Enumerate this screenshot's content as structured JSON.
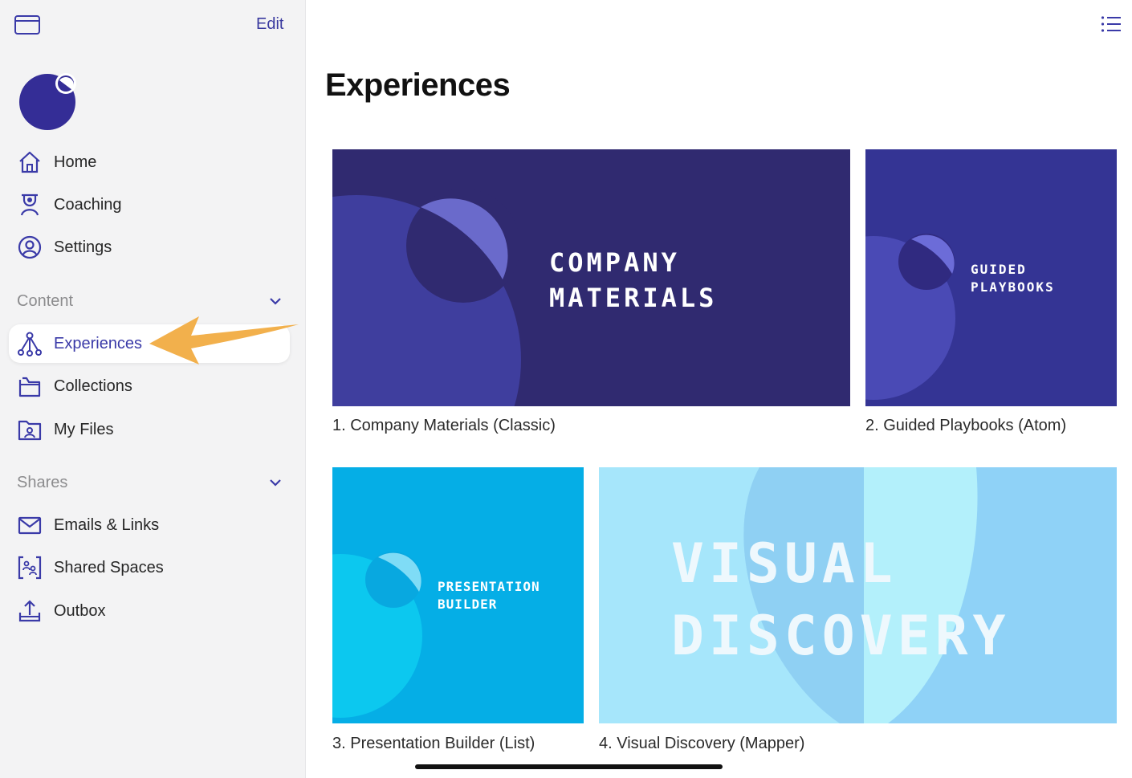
{
  "sidebar": {
    "edit_label": "Edit",
    "nav": [
      {
        "label": "Home",
        "icon": "home-icon"
      },
      {
        "label": "Coaching",
        "icon": "coaching-icon"
      },
      {
        "label": "Settings",
        "icon": "user-circle-icon"
      }
    ],
    "content_section": {
      "label": "Content",
      "items": [
        {
          "label": "Experiences",
          "icon": "experiences-icon",
          "active": true
        },
        {
          "label": "Collections",
          "icon": "folder-icon"
        },
        {
          "label": "My Files",
          "icon": "user-folder-icon"
        }
      ]
    },
    "shares_section": {
      "label": "Shares",
      "items": [
        {
          "label": "Emails & Links",
          "icon": "mail-icon"
        },
        {
          "label": "Shared Spaces",
          "icon": "shared-spaces-icon"
        },
        {
          "label": "Outbox",
          "icon": "upload-tray-icon"
        }
      ]
    }
  },
  "main": {
    "title": "Experiences",
    "cards": [
      {
        "caption": "1. Company Materials (Classic)",
        "line1": "COMPANY",
        "line2": "MATERIALS"
      },
      {
        "caption": "2. Guided Playbooks (Atom)",
        "line1": "GUIDED",
        "line2": "PLAYBOOKS"
      },
      {
        "caption": "3. Presentation Builder (List)",
        "line1": "PRESENTATION",
        "line2": "BUILDER"
      },
      {
        "caption": "4. Visual Discovery (Mapper)",
        "line1": "VISUAL",
        "line2": "DISCOVERY"
      }
    ]
  },
  "colors": {
    "accent": "#3a3aa8",
    "card1_bg": "#302a70",
    "card2_bg": "#343494",
    "card3_bg": "#05aee6",
    "card4_bg": "#8fd2f7",
    "arrow": "#f2b04c"
  }
}
